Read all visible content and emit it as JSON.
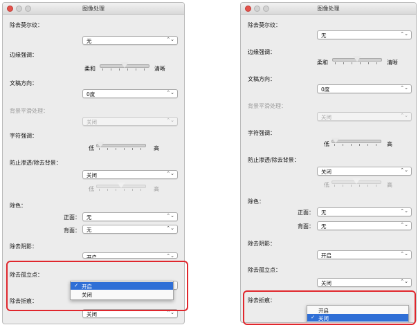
{
  "window_title": "图像处理",
  "labels": {
    "moire": "除去莫尔纹：",
    "edge": "边缘强调：",
    "orientation": "文稿方向：",
    "bg_smooth": "背景平滑处理：",
    "char_emph": "字符强调：",
    "bleed": "防止渗透/除去背景：",
    "dropout": "除色：",
    "front": "正面：",
    "back": "背面：",
    "shadow": "除去阴影：",
    "isolated": "除去孤立点：",
    "crease": "除去折痕："
  },
  "values": {
    "moire": "无",
    "orientation": "0度",
    "bg_smooth": "关闭",
    "bleed": "关闭",
    "front": "无",
    "back": "无",
    "shadow": "开启",
    "isolated": "关闭",
    "crease": "关闭"
  },
  "slider_labels": {
    "soft": "柔和",
    "sharp": "清晰",
    "low": "低",
    "high": "高"
  },
  "sliders": {
    "edge_level": 0.5,
    "char_level": 0.0,
    "bleed_level": 0.5
  },
  "arrow": "⌃⌄",
  "popup_left": {
    "items": [
      "开启",
      "关闭"
    ],
    "selected": "开启",
    "check": "✓"
  },
  "popup_right": {
    "items": [
      "开启",
      "关闭"
    ],
    "selected": "关闭",
    "check": "✓"
  },
  "highlight_color": "#2f6fd6",
  "callout_color": "#e0262c"
}
